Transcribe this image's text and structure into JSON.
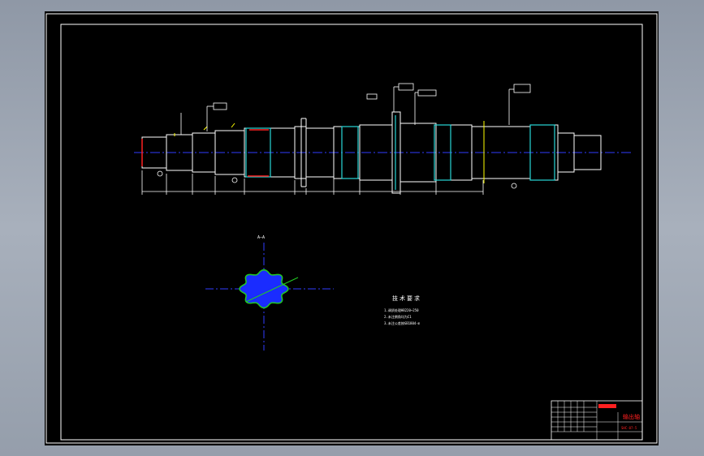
{
  "colors": {
    "background": "#000000",
    "workspace": "#9ba3af",
    "outline": "#ffffff",
    "centerline": "#2f3dff",
    "cyan": "#28d7d7",
    "yellow": "#ffff00",
    "red": "#ff2020",
    "green": "#22cc22",
    "hatch": "#1a2cff"
  },
  "drawing": {
    "section_label": "A—A",
    "section_marker": "A",
    "tech_requirements": {
      "title": "技术要求",
      "items": [
        "1.调质处理HB220~250",
        "2.未注倒角均为C1",
        "3.未注公差按GB1804-m"
      ]
    },
    "title_block": {
      "part_name": "输出轴",
      "drawing_no": "SHC-07-5"
    }
  }
}
